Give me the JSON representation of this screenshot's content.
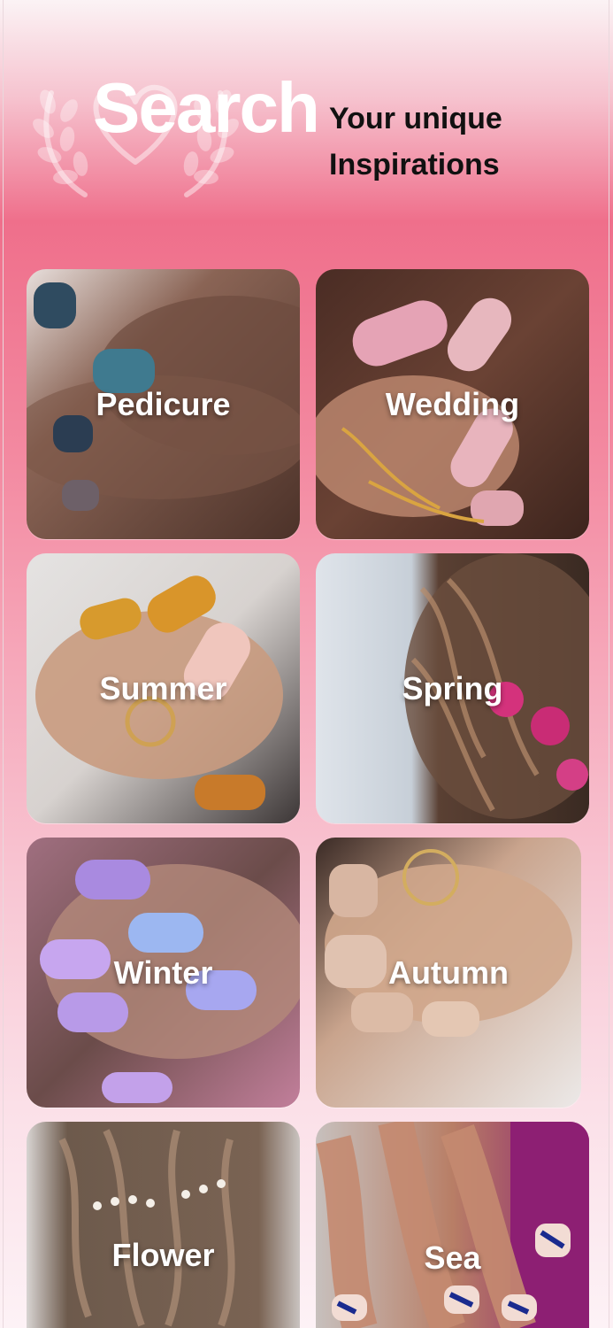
{
  "header": {
    "search_word": "Search",
    "tagline_line1": "Your unique",
    "tagline_line2": "Inspirations",
    "emblem_icon": "heart-laurel-icon"
  },
  "categories": [
    {
      "label": "Pedicure",
      "tone": "#6e5146"
    },
    {
      "label": "Wedding",
      "tone": "#5d3a2f"
    },
    {
      "label": "Summer",
      "tone": "#b28a76"
    },
    {
      "label": "Spring",
      "tone": "#6a4e3d"
    },
    {
      "label": "Winter",
      "tone": "#8a6a8c"
    },
    {
      "label": "Autumn",
      "tone": "#c7a18a"
    },
    {
      "label": "Flower",
      "tone": "#6d5a4c"
    },
    {
      "label": "Sea",
      "tone": "#a06b57"
    }
  ],
  "colors": {
    "accent": "#ef6f8b",
    "text_dark": "#111111",
    "text_light": "#ffffff"
  }
}
